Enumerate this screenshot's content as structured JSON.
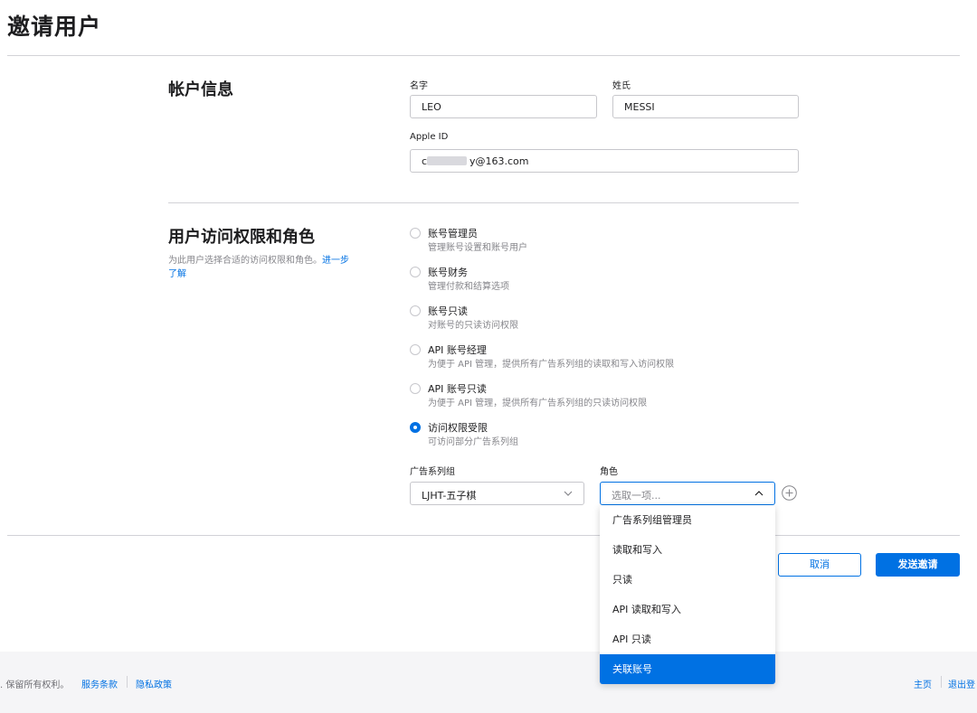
{
  "page": {
    "title": "邀请用户"
  },
  "account_info": {
    "title": "帐户信息",
    "first_name_label": "名字",
    "first_name_value": "LEO",
    "last_name_label": "姓氏",
    "last_name_value": "MESSI",
    "apple_id_label": "Apple ID",
    "apple_id_prefix": "c",
    "apple_id_suffix": "y@163.com"
  },
  "access": {
    "title": "用户访问权限和角色",
    "description": "为此用户选择合适的访问权限和角色。",
    "learn_more_line1": "进一步",
    "learn_more_line2": "了解",
    "options": [
      {
        "label": "账号管理员",
        "desc": "管理账号设置和账号用户",
        "checked": false
      },
      {
        "label": "账号财务",
        "desc": "管理付款和结算选项",
        "checked": false
      },
      {
        "label": "账号只读",
        "desc": "对账号的只读访问权限",
        "checked": false
      },
      {
        "label": "API 账号经理",
        "desc": "为便于 API 管理，提供所有广告系列组的读取和写入访问权限",
        "checked": false
      },
      {
        "label": "API 账号只读",
        "desc": "为便于 API 管理，提供所有广告系列组的只读访问权限",
        "checked": false
      },
      {
        "label": "访问权限受限",
        "desc": "可访问部分广告系列组",
        "checked": true
      }
    ]
  },
  "restricted": {
    "campaign_group_label": "广告系列组",
    "campaign_group_value": "LJHT-五子棋",
    "role_label": "角色",
    "role_placeholder": "选取一项...",
    "role_options": [
      "广告系列组管理员",
      "读取和写入",
      "只读",
      "API 读取和写入",
      "API 只读",
      "关联账号"
    ],
    "role_highlighted": "关联账号"
  },
  "actions": {
    "cancel_label": "取消",
    "send_label": "发送邀请"
  },
  "footer": {
    "copyright": ". 保留所有权利。",
    "terms_link": "服务条款",
    "privacy_link": "隐私政策",
    "home_link": "主页",
    "logout_link": "退出登"
  },
  "colors": {
    "accent": "#0071e3",
    "text": "#1d1d1f",
    "muted": "#86868b",
    "border": "#c7c7cc",
    "footer_bg": "#f5f5f7"
  }
}
